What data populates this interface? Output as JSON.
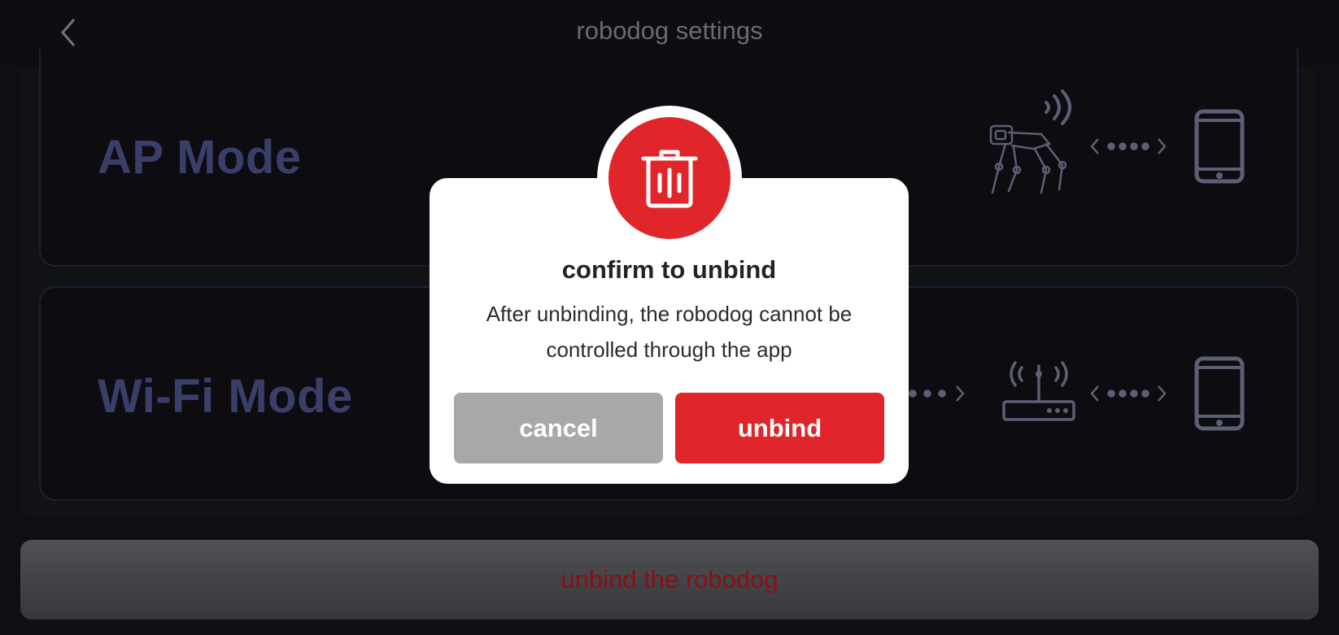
{
  "header": {
    "title": "robodog settings",
    "back_icon": "chevron-left-icon"
  },
  "modes": [
    {
      "label": "AP Mode",
      "icons": [
        "robodog-icon",
        "wireless-signal-icon",
        "connection-arrows-icon",
        "phone-icon"
      ]
    },
    {
      "label": "Wi-Fi Mode",
      "icons": [
        "connection-arrows-icon",
        "router-icon",
        "connection-arrows-icon",
        "phone-icon"
      ]
    }
  ],
  "footer": {
    "unbind_label": "unbind the robodog"
  },
  "dialog": {
    "icon": "trash-icon",
    "title": "confirm to unbind",
    "message": "After unbinding, the robodog cannot be controlled through the app",
    "cancel_label": "cancel",
    "confirm_label": "unbind"
  },
  "colors": {
    "accent_red": "#e0262b",
    "mode_label": "#4c558c",
    "icon_gray": "#7b7f9c"
  }
}
